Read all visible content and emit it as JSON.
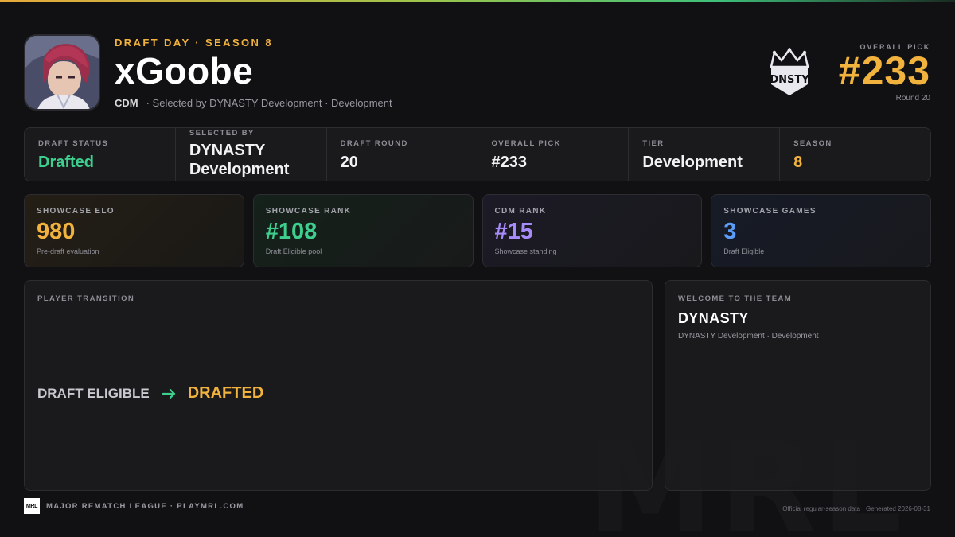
{
  "header": {
    "eyebrow": "DRAFT DAY · SEASON 8",
    "player_name": "xGoobe",
    "position": "CDM",
    "selection_note": "· Selected by DYNASTY Development · Development",
    "avatar_icon": "player-avatar-portrait",
    "team_logo_text": "DNSTY",
    "overall_pick_label": "OVERALL PICK",
    "overall_pick_value": "#233",
    "round_text": "Round 20"
  },
  "info_strip": [
    {
      "label": "DRAFT STATUS",
      "value": "Drafted"
    },
    {
      "label": "SELECTED BY",
      "value": "DYNASTY Development"
    },
    {
      "label": "DRAFT ROUND",
      "value": "20"
    },
    {
      "label": "OVERALL PICK",
      "value": "#233"
    },
    {
      "label": "TIER",
      "value": "Development"
    },
    {
      "label": "SEASON",
      "value": "8"
    }
  ],
  "stat_cards": [
    {
      "label": "SHOWCASE ELO",
      "value": "980",
      "caption": "Pre-draft evaluation",
      "color": "#f2b23e"
    },
    {
      "label": "SHOWCASE RANK",
      "value": "#108",
      "caption": "Draft Eligible pool",
      "color": "#3ecf8e"
    },
    {
      "label": "CDM RANK",
      "value": "#15",
      "caption": "Showcase standing",
      "color": "#a78bfa"
    },
    {
      "label": "SHOWCASE GAMES",
      "value": "3",
      "caption": "Draft Eligible",
      "color": "#5b9cf6"
    }
  ],
  "transition_panel": {
    "label": "PLAYER TRANSITION",
    "from": "DRAFT ELIGIBLE",
    "to": "DRAFTED",
    "arrow_icon": "arrow-right-icon"
  },
  "welcome_panel": {
    "label": "WELCOME TO THE TEAM",
    "team": "DYNASTY",
    "subtitle": "DYNASTY Development · Development"
  },
  "footer": {
    "logo_text": "MRL",
    "league_text": "MAJOR REMATCH LEAGUE · PLAYMRL.COM",
    "generated_text": "Official regular-season data · Generated 2026-08-31",
    "watermark": "MRL"
  },
  "colors": {
    "accent_gold": "#f2b23e",
    "accent_green": "#3ecf8e",
    "accent_purple": "#a78bfa",
    "accent_blue": "#5b9cf6",
    "background": "#111113"
  }
}
